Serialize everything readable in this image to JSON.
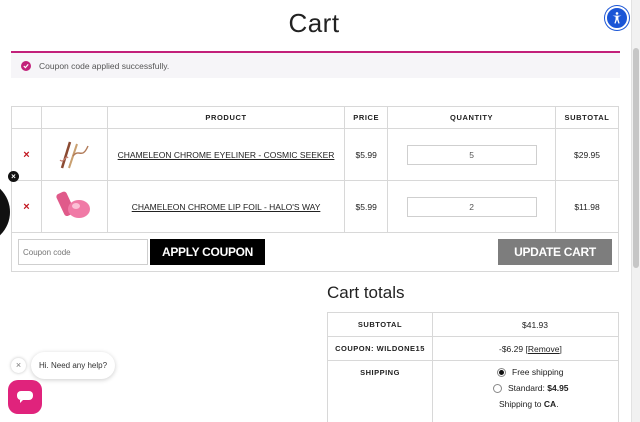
{
  "page": {
    "title": "Cart"
  },
  "notice": {
    "message": "Coupon code applied successfully."
  },
  "cart_table": {
    "headers": {
      "product": "PRODUCT",
      "price": "PRICE",
      "quantity": "QUANTITY",
      "subtotal": "SUBTOTAL"
    },
    "rows": [
      {
        "name": "CHAMELEON CHROME EYELINER - COSMIC SEEKER",
        "price": "$5.99",
        "quantity": "5",
        "subtotal": "$29.95",
        "thumb_icon": "eyeliner-product-image"
      },
      {
        "name": "CHAMELEON CHROME LIP FOIL - HALO'S WAY",
        "price": "$5.99",
        "quantity": "2",
        "subtotal": "$11.98",
        "thumb_icon": "lip-foil-product-image"
      }
    ],
    "remove_symbol": "×"
  },
  "actions": {
    "coupon_placeholder": "Coupon code",
    "apply_label": "APPLY COUPON",
    "update_label": "UPDATE CART"
  },
  "totals": {
    "title": "Cart totals",
    "subtotal_label": "SUBTOTAL",
    "subtotal_value": "$41.93",
    "coupon_label": "COUPON: WILDONE15",
    "coupon_value": "-$6.29",
    "coupon_remove": "[Remove]",
    "shipping_label": "SHIPPING",
    "shipping_options": [
      {
        "label": "Free shipping",
        "selected": true
      },
      {
        "label": "Standard:",
        "price": "$4.95",
        "selected": false
      }
    ],
    "shipping_to_prefix": "Shipping to",
    "shipping_to_region": "CA",
    "shipping_to_suffix": "."
  },
  "chat": {
    "message": "Hi. Need any help?",
    "close_symbol": "×"
  },
  "side_widget": {
    "close_symbol": "×"
  },
  "colors": {
    "accent": "#c2207a",
    "accessibility": "#1a55d6",
    "chat": "#e0237c",
    "remove": "#c2161f"
  }
}
